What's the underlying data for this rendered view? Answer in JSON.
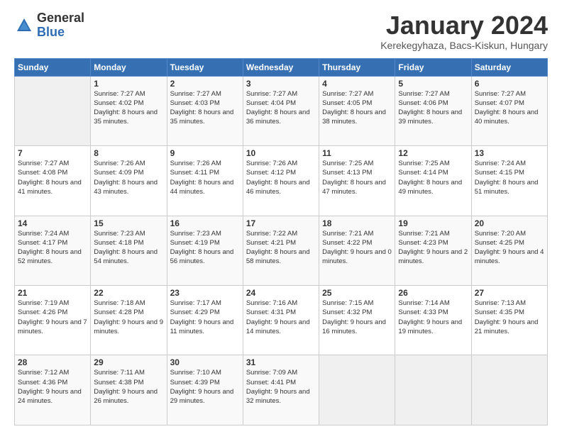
{
  "header": {
    "logo_general": "General",
    "logo_blue": "Blue",
    "month_title": "January 2024",
    "subtitle": "Kerekegyhaza, Bacs-Kiskun, Hungary"
  },
  "weekdays": [
    "Sunday",
    "Monday",
    "Tuesday",
    "Wednesday",
    "Thursday",
    "Friday",
    "Saturday"
  ],
  "weeks": [
    [
      {
        "day": "",
        "sunrise": "",
        "sunset": "",
        "daylight": ""
      },
      {
        "day": "1",
        "sunrise": "Sunrise: 7:27 AM",
        "sunset": "Sunset: 4:02 PM",
        "daylight": "Daylight: 8 hours and 35 minutes."
      },
      {
        "day": "2",
        "sunrise": "Sunrise: 7:27 AM",
        "sunset": "Sunset: 4:03 PM",
        "daylight": "Daylight: 8 hours and 35 minutes."
      },
      {
        "day": "3",
        "sunrise": "Sunrise: 7:27 AM",
        "sunset": "Sunset: 4:04 PM",
        "daylight": "Daylight: 8 hours and 36 minutes."
      },
      {
        "day": "4",
        "sunrise": "Sunrise: 7:27 AM",
        "sunset": "Sunset: 4:05 PM",
        "daylight": "Daylight: 8 hours and 38 minutes."
      },
      {
        "day": "5",
        "sunrise": "Sunrise: 7:27 AM",
        "sunset": "Sunset: 4:06 PM",
        "daylight": "Daylight: 8 hours and 39 minutes."
      },
      {
        "day": "6",
        "sunrise": "Sunrise: 7:27 AM",
        "sunset": "Sunset: 4:07 PM",
        "daylight": "Daylight: 8 hours and 40 minutes."
      }
    ],
    [
      {
        "day": "7",
        "sunrise": "Sunrise: 7:27 AM",
        "sunset": "Sunset: 4:08 PM",
        "daylight": "Daylight: 8 hours and 41 minutes."
      },
      {
        "day": "8",
        "sunrise": "Sunrise: 7:26 AM",
        "sunset": "Sunset: 4:09 PM",
        "daylight": "Daylight: 8 hours and 43 minutes."
      },
      {
        "day": "9",
        "sunrise": "Sunrise: 7:26 AM",
        "sunset": "Sunset: 4:11 PM",
        "daylight": "Daylight: 8 hours and 44 minutes."
      },
      {
        "day": "10",
        "sunrise": "Sunrise: 7:26 AM",
        "sunset": "Sunset: 4:12 PM",
        "daylight": "Daylight: 8 hours and 46 minutes."
      },
      {
        "day": "11",
        "sunrise": "Sunrise: 7:25 AM",
        "sunset": "Sunset: 4:13 PM",
        "daylight": "Daylight: 8 hours and 47 minutes."
      },
      {
        "day": "12",
        "sunrise": "Sunrise: 7:25 AM",
        "sunset": "Sunset: 4:14 PM",
        "daylight": "Daylight: 8 hours and 49 minutes."
      },
      {
        "day": "13",
        "sunrise": "Sunrise: 7:24 AM",
        "sunset": "Sunset: 4:15 PM",
        "daylight": "Daylight: 8 hours and 51 minutes."
      }
    ],
    [
      {
        "day": "14",
        "sunrise": "Sunrise: 7:24 AM",
        "sunset": "Sunset: 4:17 PM",
        "daylight": "Daylight: 8 hours and 52 minutes."
      },
      {
        "day": "15",
        "sunrise": "Sunrise: 7:23 AM",
        "sunset": "Sunset: 4:18 PM",
        "daylight": "Daylight: 8 hours and 54 minutes."
      },
      {
        "day": "16",
        "sunrise": "Sunrise: 7:23 AM",
        "sunset": "Sunset: 4:19 PM",
        "daylight": "Daylight: 8 hours and 56 minutes."
      },
      {
        "day": "17",
        "sunrise": "Sunrise: 7:22 AM",
        "sunset": "Sunset: 4:21 PM",
        "daylight": "Daylight: 8 hours and 58 minutes."
      },
      {
        "day": "18",
        "sunrise": "Sunrise: 7:21 AM",
        "sunset": "Sunset: 4:22 PM",
        "daylight": "Daylight: 9 hours and 0 minutes."
      },
      {
        "day": "19",
        "sunrise": "Sunrise: 7:21 AM",
        "sunset": "Sunset: 4:23 PM",
        "daylight": "Daylight: 9 hours and 2 minutes."
      },
      {
        "day": "20",
        "sunrise": "Sunrise: 7:20 AM",
        "sunset": "Sunset: 4:25 PM",
        "daylight": "Daylight: 9 hours and 4 minutes."
      }
    ],
    [
      {
        "day": "21",
        "sunrise": "Sunrise: 7:19 AM",
        "sunset": "Sunset: 4:26 PM",
        "daylight": "Daylight: 9 hours and 7 minutes."
      },
      {
        "day": "22",
        "sunrise": "Sunrise: 7:18 AM",
        "sunset": "Sunset: 4:28 PM",
        "daylight": "Daylight: 9 hours and 9 minutes."
      },
      {
        "day": "23",
        "sunrise": "Sunrise: 7:17 AM",
        "sunset": "Sunset: 4:29 PM",
        "daylight": "Daylight: 9 hours and 11 minutes."
      },
      {
        "day": "24",
        "sunrise": "Sunrise: 7:16 AM",
        "sunset": "Sunset: 4:31 PM",
        "daylight": "Daylight: 9 hours and 14 minutes."
      },
      {
        "day": "25",
        "sunrise": "Sunrise: 7:15 AM",
        "sunset": "Sunset: 4:32 PM",
        "daylight": "Daylight: 9 hours and 16 minutes."
      },
      {
        "day": "26",
        "sunrise": "Sunrise: 7:14 AM",
        "sunset": "Sunset: 4:33 PM",
        "daylight": "Daylight: 9 hours and 19 minutes."
      },
      {
        "day": "27",
        "sunrise": "Sunrise: 7:13 AM",
        "sunset": "Sunset: 4:35 PM",
        "daylight": "Daylight: 9 hours and 21 minutes."
      }
    ],
    [
      {
        "day": "28",
        "sunrise": "Sunrise: 7:12 AM",
        "sunset": "Sunset: 4:36 PM",
        "daylight": "Daylight: 9 hours and 24 minutes."
      },
      {
        "day": "29",
        "sunrise": "Sunrise: 7:11 AM",
        "sunset": "Sunset: 4:38 PM",
        "daylight": "Daylight: 9 hours and 26 minutes."
      },
      {
        "day": "30",
        "sunrise": "Sunrise: 7:10 AM",
        "sunset": "Sunset: 4:39 PM",
        "daylight": "Daylight: 9 hours and 29 minutes."
      },
      {
        "day": "31",
        "sunrise": "Sunrise: 7:09 AM",
        "sunset": "Sunset: 4:41 PM",
        "daylight": "Daylight: 9 hours and 32 minutes."
      },
      {
        "day": "",
        "sunrise": "",
        "sunset": "",
        "daylight": ""
      },
      {
        "day": "",
        "sunrise": "",
        "sunset": "",
        "daylight": ""
      },
      {
        "day": "",
        "sunrise": "",
        "sunset": "",
        "daylight": ""
      }
    ]
  ]
}
